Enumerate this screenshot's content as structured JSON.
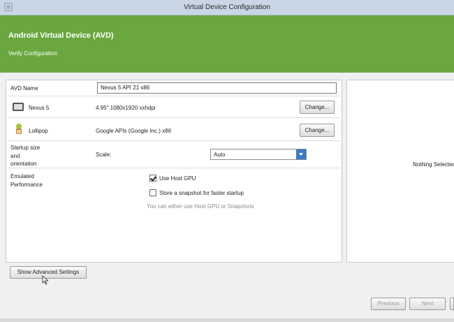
{
  "window": {
    "title": "Virtual Device Configuration"
  },
  "banner": {
    "heading": "Android Virtual Device (AVD)",
    "subheading": "Verify Configuration"
  },
  "form": {
    "avd_name": {
      "label": "AVD Name",
      "value": "Nexus 5 API 21 x86"
    },
    "device": {
      "name": "Nexus 5",
      "spec": "4.95\" 1080x1920 xxhdpi",
      "change_label": "Change...",
      "icon": "phone-icon"
    },
    "system_image": {
      "name": "Lollipop",
      "spec": "Google APIs (Google Inc.) x86",
      "change_label": "Change...",
      "icon": "android-icon"
    },
    "startup": {
      "label_lines": [
        "Startup size",
        "and",
        "orientation"
      ],
      "scale_label": "Scale:",
      "scale_value": "Auto"
    },
    "performance": {
      "label_lines": [
        "Emulated",
        "Performance"
      ],
      "use_host_gpu": {
        "label": "Use Host GPU",
        "checked": true
      },
      "snapshot": {
        "label": "Store a snapshot for faster startup",
        "checked": false
      },
      "hint": "You can either use Host GPU or Snapshots"
    }
  },
  "preview": {
    "message": "Nothing Selected"
  },
  "footer": {
    "advanced_label": "Show Advanced Settings",
    "previous_label": "Previous",
    "next_label": "Next"
  },
  "colors": {
    "banner": "#6aa83f",
    "titlebar": "#c8d6e6",
    "select_arrow": "#3b79c5"
  }
}
